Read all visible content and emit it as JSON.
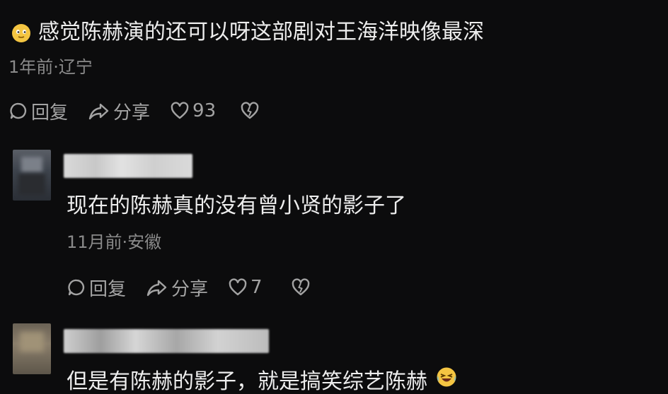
{
  "comments": [
    {
      "text": "感觉陈赫演的还可以呀这部剧对王海洋映像最深",
      "meta": "1年前·辽宁",
      "reply_label": "回复",
      "share_label": "分享",
      "like_count": "93",
      "emoji": "smiling-face-icon"
    },
    {
      "text": "现在的陈赫真的没有曾小贤的影子了",
      "meta": "11月前·安徽",
      "reply_label": "回复",
      "share_label": "分享",
      "like_count": "7"
    },
    {
      "text": "但是有陈赫的影子，就是搞笑综艺陈赫",
      "emoji": "laughing-crying-face-icon"
    }
  ],
  "colors": {
    "background": "#0c0c0d",
    "text": "#ededed",
    "meta": "#8a8a8a",
    "icon": "#9a9a9a"
  }
}
